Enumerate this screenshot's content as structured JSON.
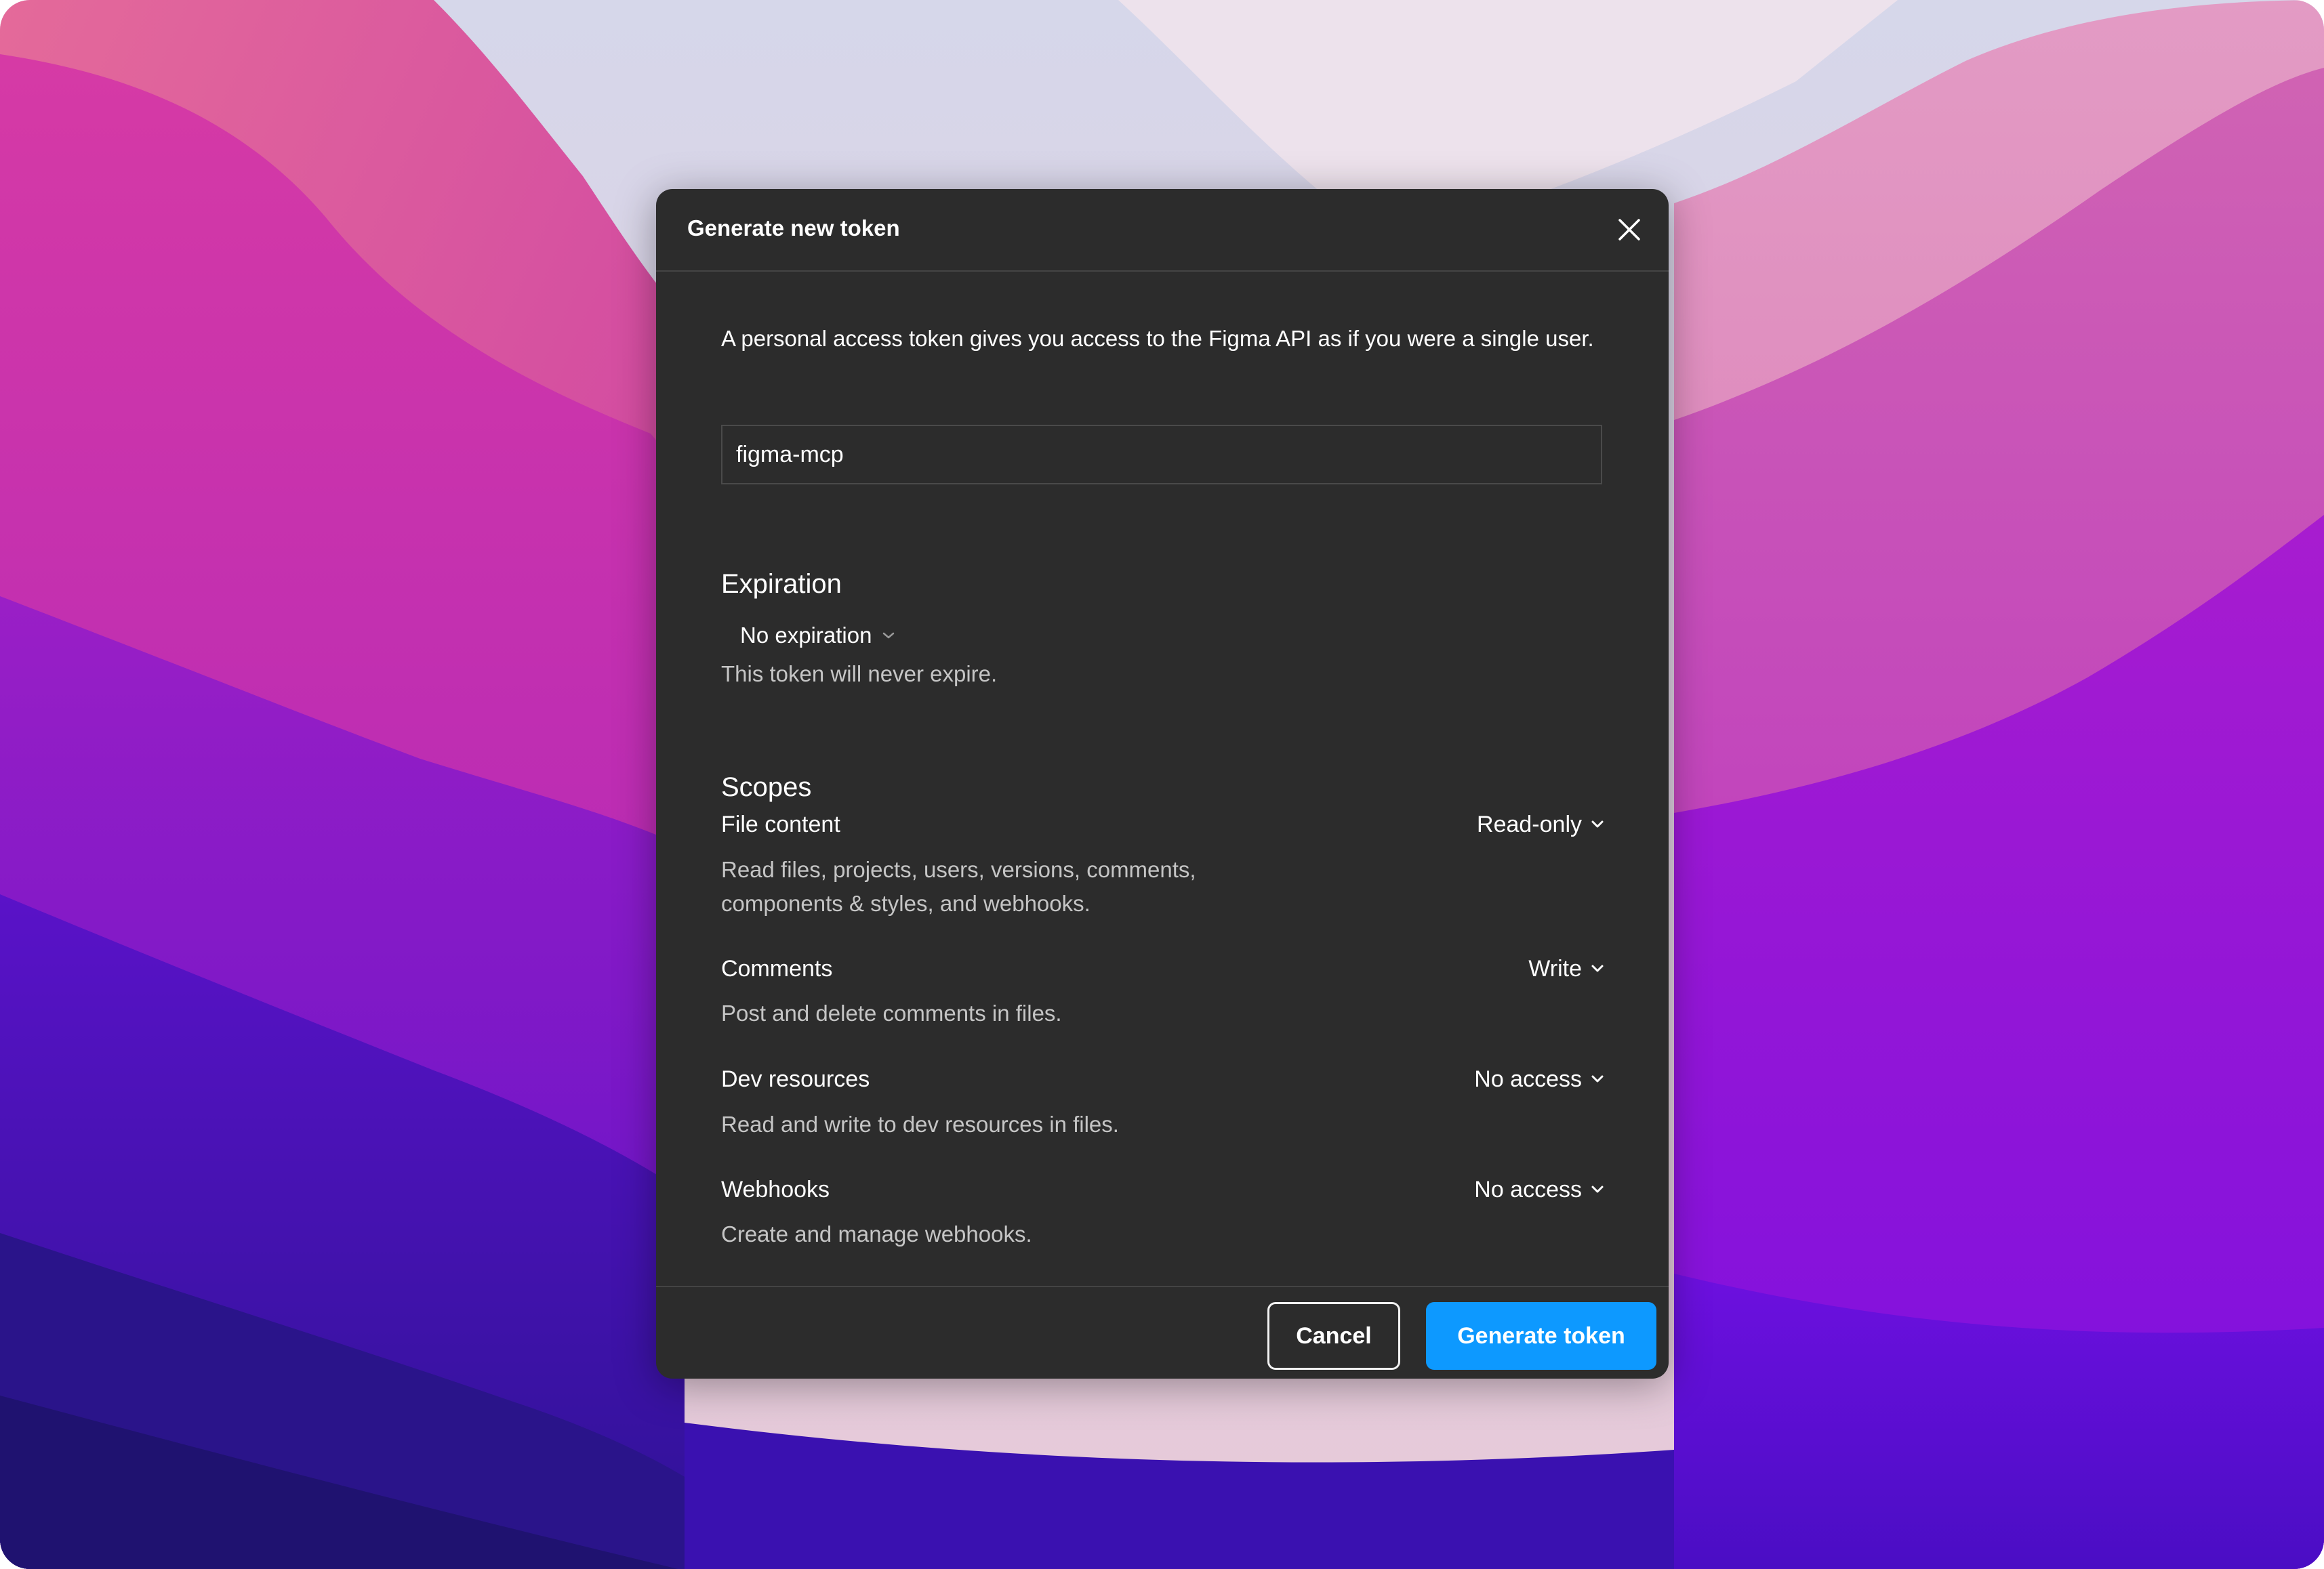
{
  "dialog": {
    "title": "Generate new token",
    "description": "A personal access token gives you access to the Figma API as if you were a single user.",
    "token_name": {
      "value": "figma-mcp",
      "placeholder": ""
    },
    "expiration": {
      "heading": "Expiration",
      "selected": "No expiration",
      "note": "This token will never expire."
    },
    "scopes": {
      "heading": "Scopes",
      "items": [
        {
          "label": "File content",
          "description": "Read files, projects, users, versions, comments, components & styles, and webhooks.",
          "access": "Read-only"
        },
        {
          "label": "Comments",
          "description": "Post and delete comments in files.",
          "access": "Write"
        },
        {
          "label": "Dev resources",
          "description": "Read and write to dev resources in files.",
          "access": "No access"
        },
        {
          "label": "Webhooks",
          "description": "Create and manage webhooks.",
          "access": "No access"
        }
      ]
    },
    "buttons": {
      "cancel": "Cancel",
      "generate": "Generate token"
    }
  },
  "icons": {
    "close": "close-icon",
    "chevron": "chevron-down-icon"
  },
  "colors": {
    "dialog_bg": "#2c2c2c",
    "primary": "#0d99ff",
    "muted_text": "#c5c5c5",
    "divider": "#444444"
  }
}
